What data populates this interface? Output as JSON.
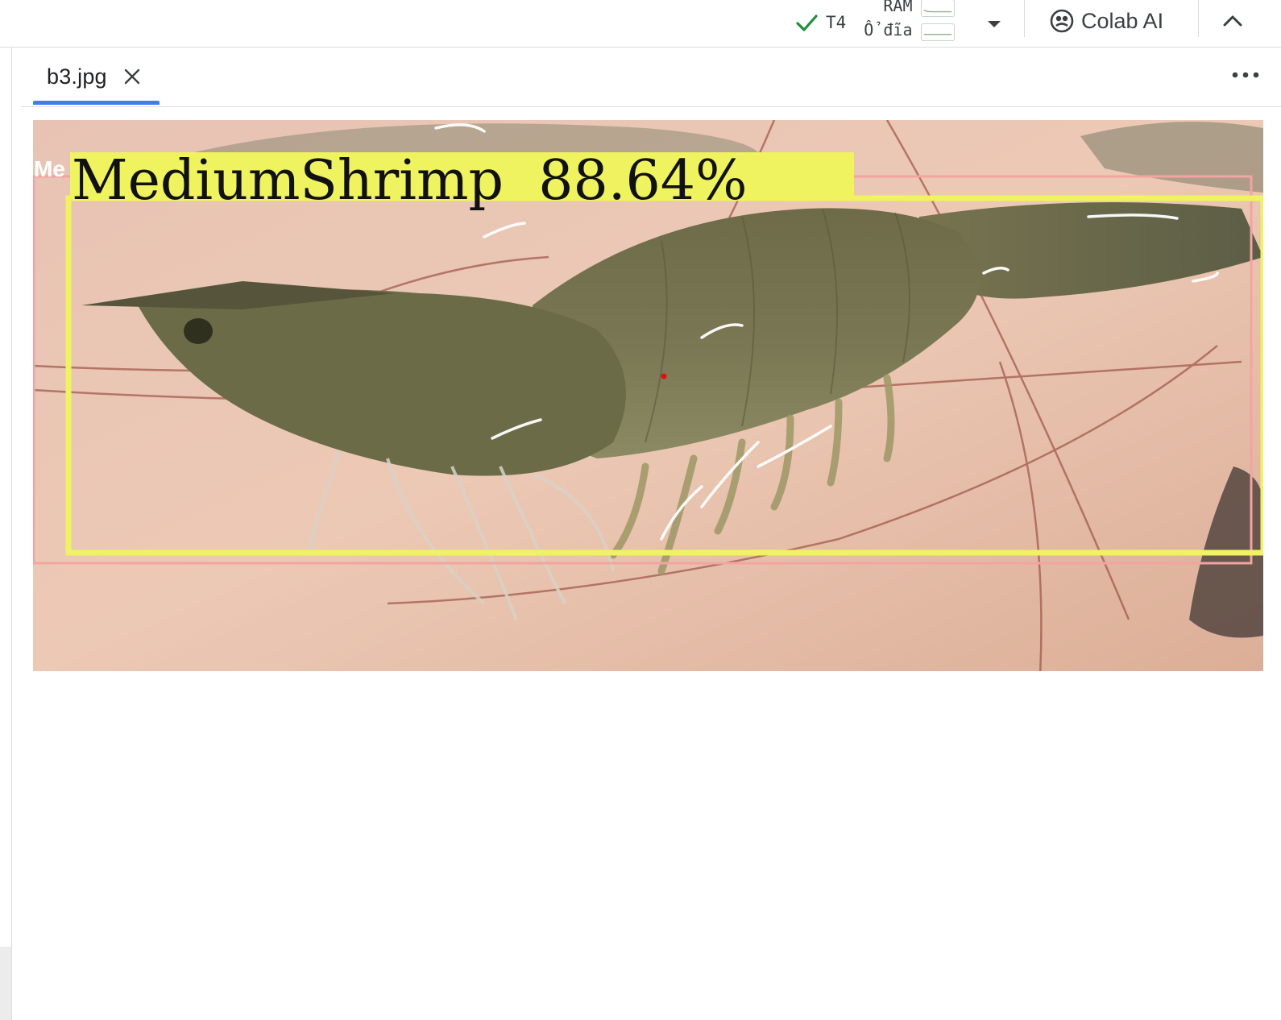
{
  "toolbar": {
    "runtime_status": "connected",
    "gpu": "T4",
    "ram_label": "RAM",
    "disk_label": "Ổ đĩa",
    "colab_ai": "Colab AI"
  },
  "tab": {
    "filename": "b3.jpg"
  },
  "image": {
    "detection_label": "MediumShrimp  88.64%",
    "secondary_label": "Me",
    "primary_box_color": "#eef35f",
    "secondary_box_color": "#f4a3a3",
    "center_point_color": "#e01010"
  },
  "colors": {
    "accent_tab": "#4479f0",
    "check_green": "#1e8e3e"
  }
}
